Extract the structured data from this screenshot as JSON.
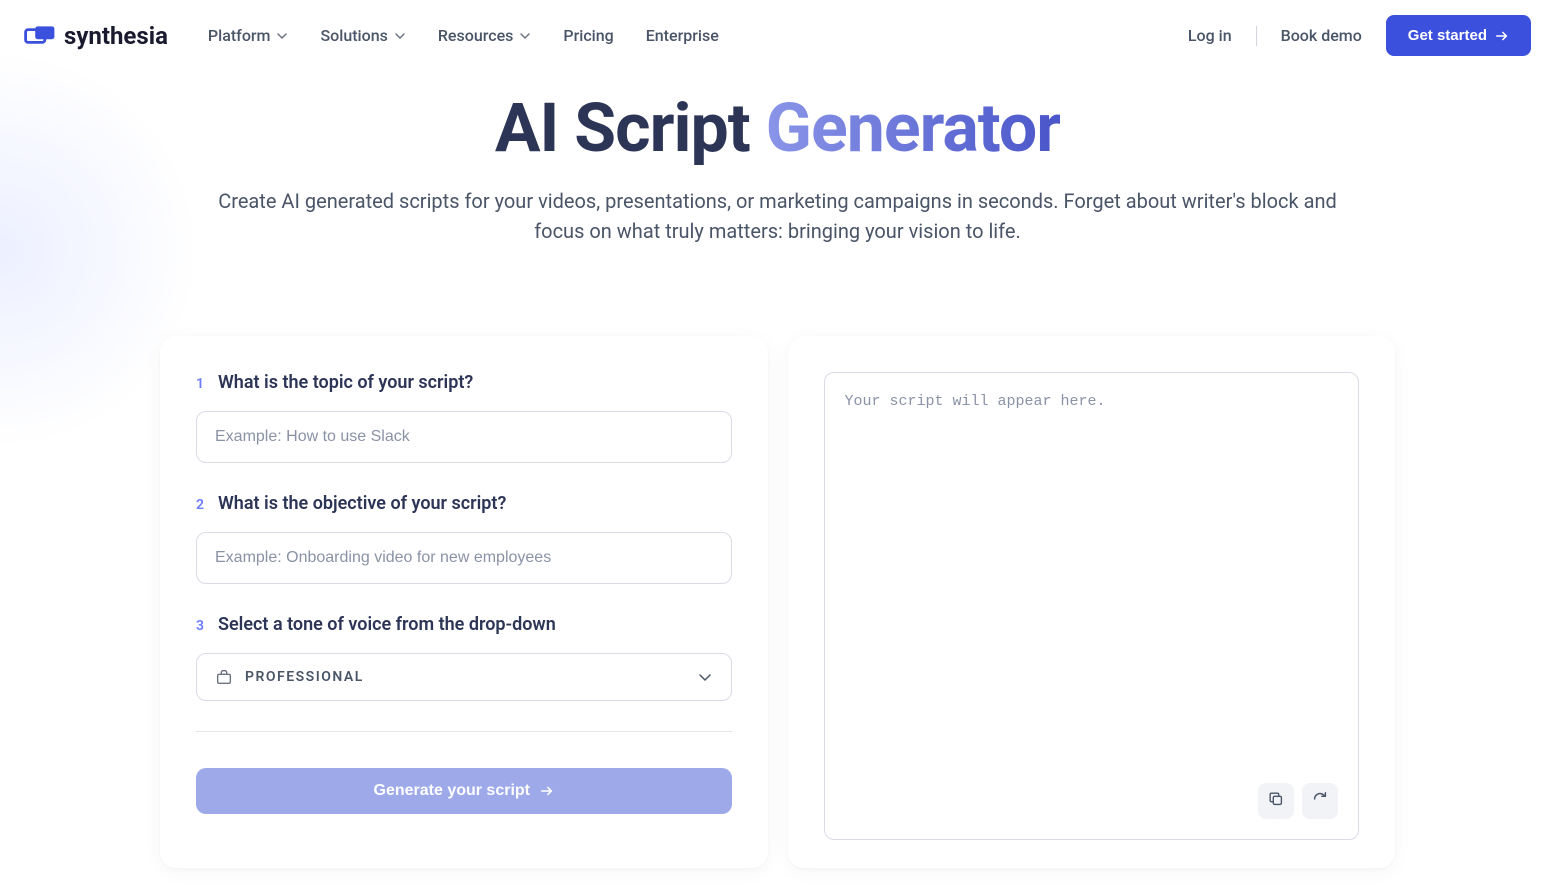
{
  "header": {
    "logo_text": "synthesia",
    "nav": [
      {
        "label": "Platform",
        "has_dropdown": true
      },
      {
        "label": "Solutions",
        "has_dropdown": true
      },
      {
        "label": "Resources",
        "has_dropdown": true
      },
      {
        "label": "Pricing",
        "has_dropdown": false
      },
      {
        "label": "Enterprise",
        "has_dropdown": false
      }
    ],
    "login": "Log in",
    "book_demo": "Book demo",
    "get_started": "Get started"
  },
  "hero": {
    "title_part1": "AI Script ",
    "title_part2": "Generator",
    "subtitle": "Create AI generated scripts for your videos, presentations, or marketing campaigns in seconds. Forget about writer's block and focus on what truly matters: bringing your vision to life."
  },
  "form": {
    "step1": {
      "num": "1",
      "label": "What is the topic of your script?",
      "placeholder": "Example: How to use Slack"
    },
    "step2": {
      "num": "2",
      "label": "What is the objective of your script?",
      "placeholder": "Example: Onboarding video for new employees"
    },
    "step3": {
      "num": "3",
      "label": "Select a tone of voice from the drop-down",
      "selected": "PROFESSIONAL"
    },
    "generate_label": "Generate your script"
  },
  "output": {
    "placeholder": "Your script will appear here."
  }
}
